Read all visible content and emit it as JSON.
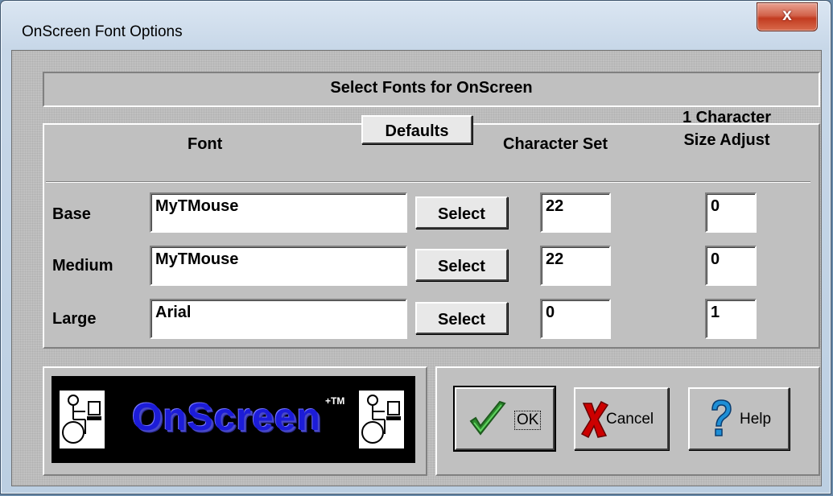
{
  "window": {
    "title": "OnScreen Font Options",
    "close_label": "x"
  },
  "header": {
    "title": "Select Fonts for OnScreen"
  },
  "columns": {
    "font": "Font",
    "defaults_label": "Defaults",
    "character_set": "Character Set",
    "size_adjust_line1": "1 Character",
    "size_adjust_line2": "Size Adjust"
  },
  "rows": [
    {
      "label": "Base",
      "font": "MyTMouse",
      "select_label": "Select",
      "character_set": "22",
      "size_adjust": "0"
    },
    {
      "label": "Medium",
      "font": "MyTMouse",
      "select_label": "Select",
      "character_set": "22",
      "size_adjust": "0"
    },
    {
      "label": "Large",
      "font": "Arial",
      "select_label": "Select",
      "character_set": "0",
      "size_adjust": "1"
    }
  ],
  "logo": {
    "text": "OnScreen",
    "tm": "+TM"
  },
  "buttons": {
    "ok": "OK",
    "cancel": "Cancel",
    "help": "Help"
  },
  "icons": {
    "close": "close-icon",
    "ok": "checkmark-icon",
    "cancel": "red-x-icon",
    "help": "question-mark-icon",
    "logo_figure": "wheelchair-user-icon"
  },
  "colors": {
    "dialog_face": "#c0c0c0",
    "logo_text": "#1c1cd8",
    "ok_check": "#2e8b2e",
    "cancel_x": "#cc0000",
    "help_q": "#1e8fd6"
  }
}
